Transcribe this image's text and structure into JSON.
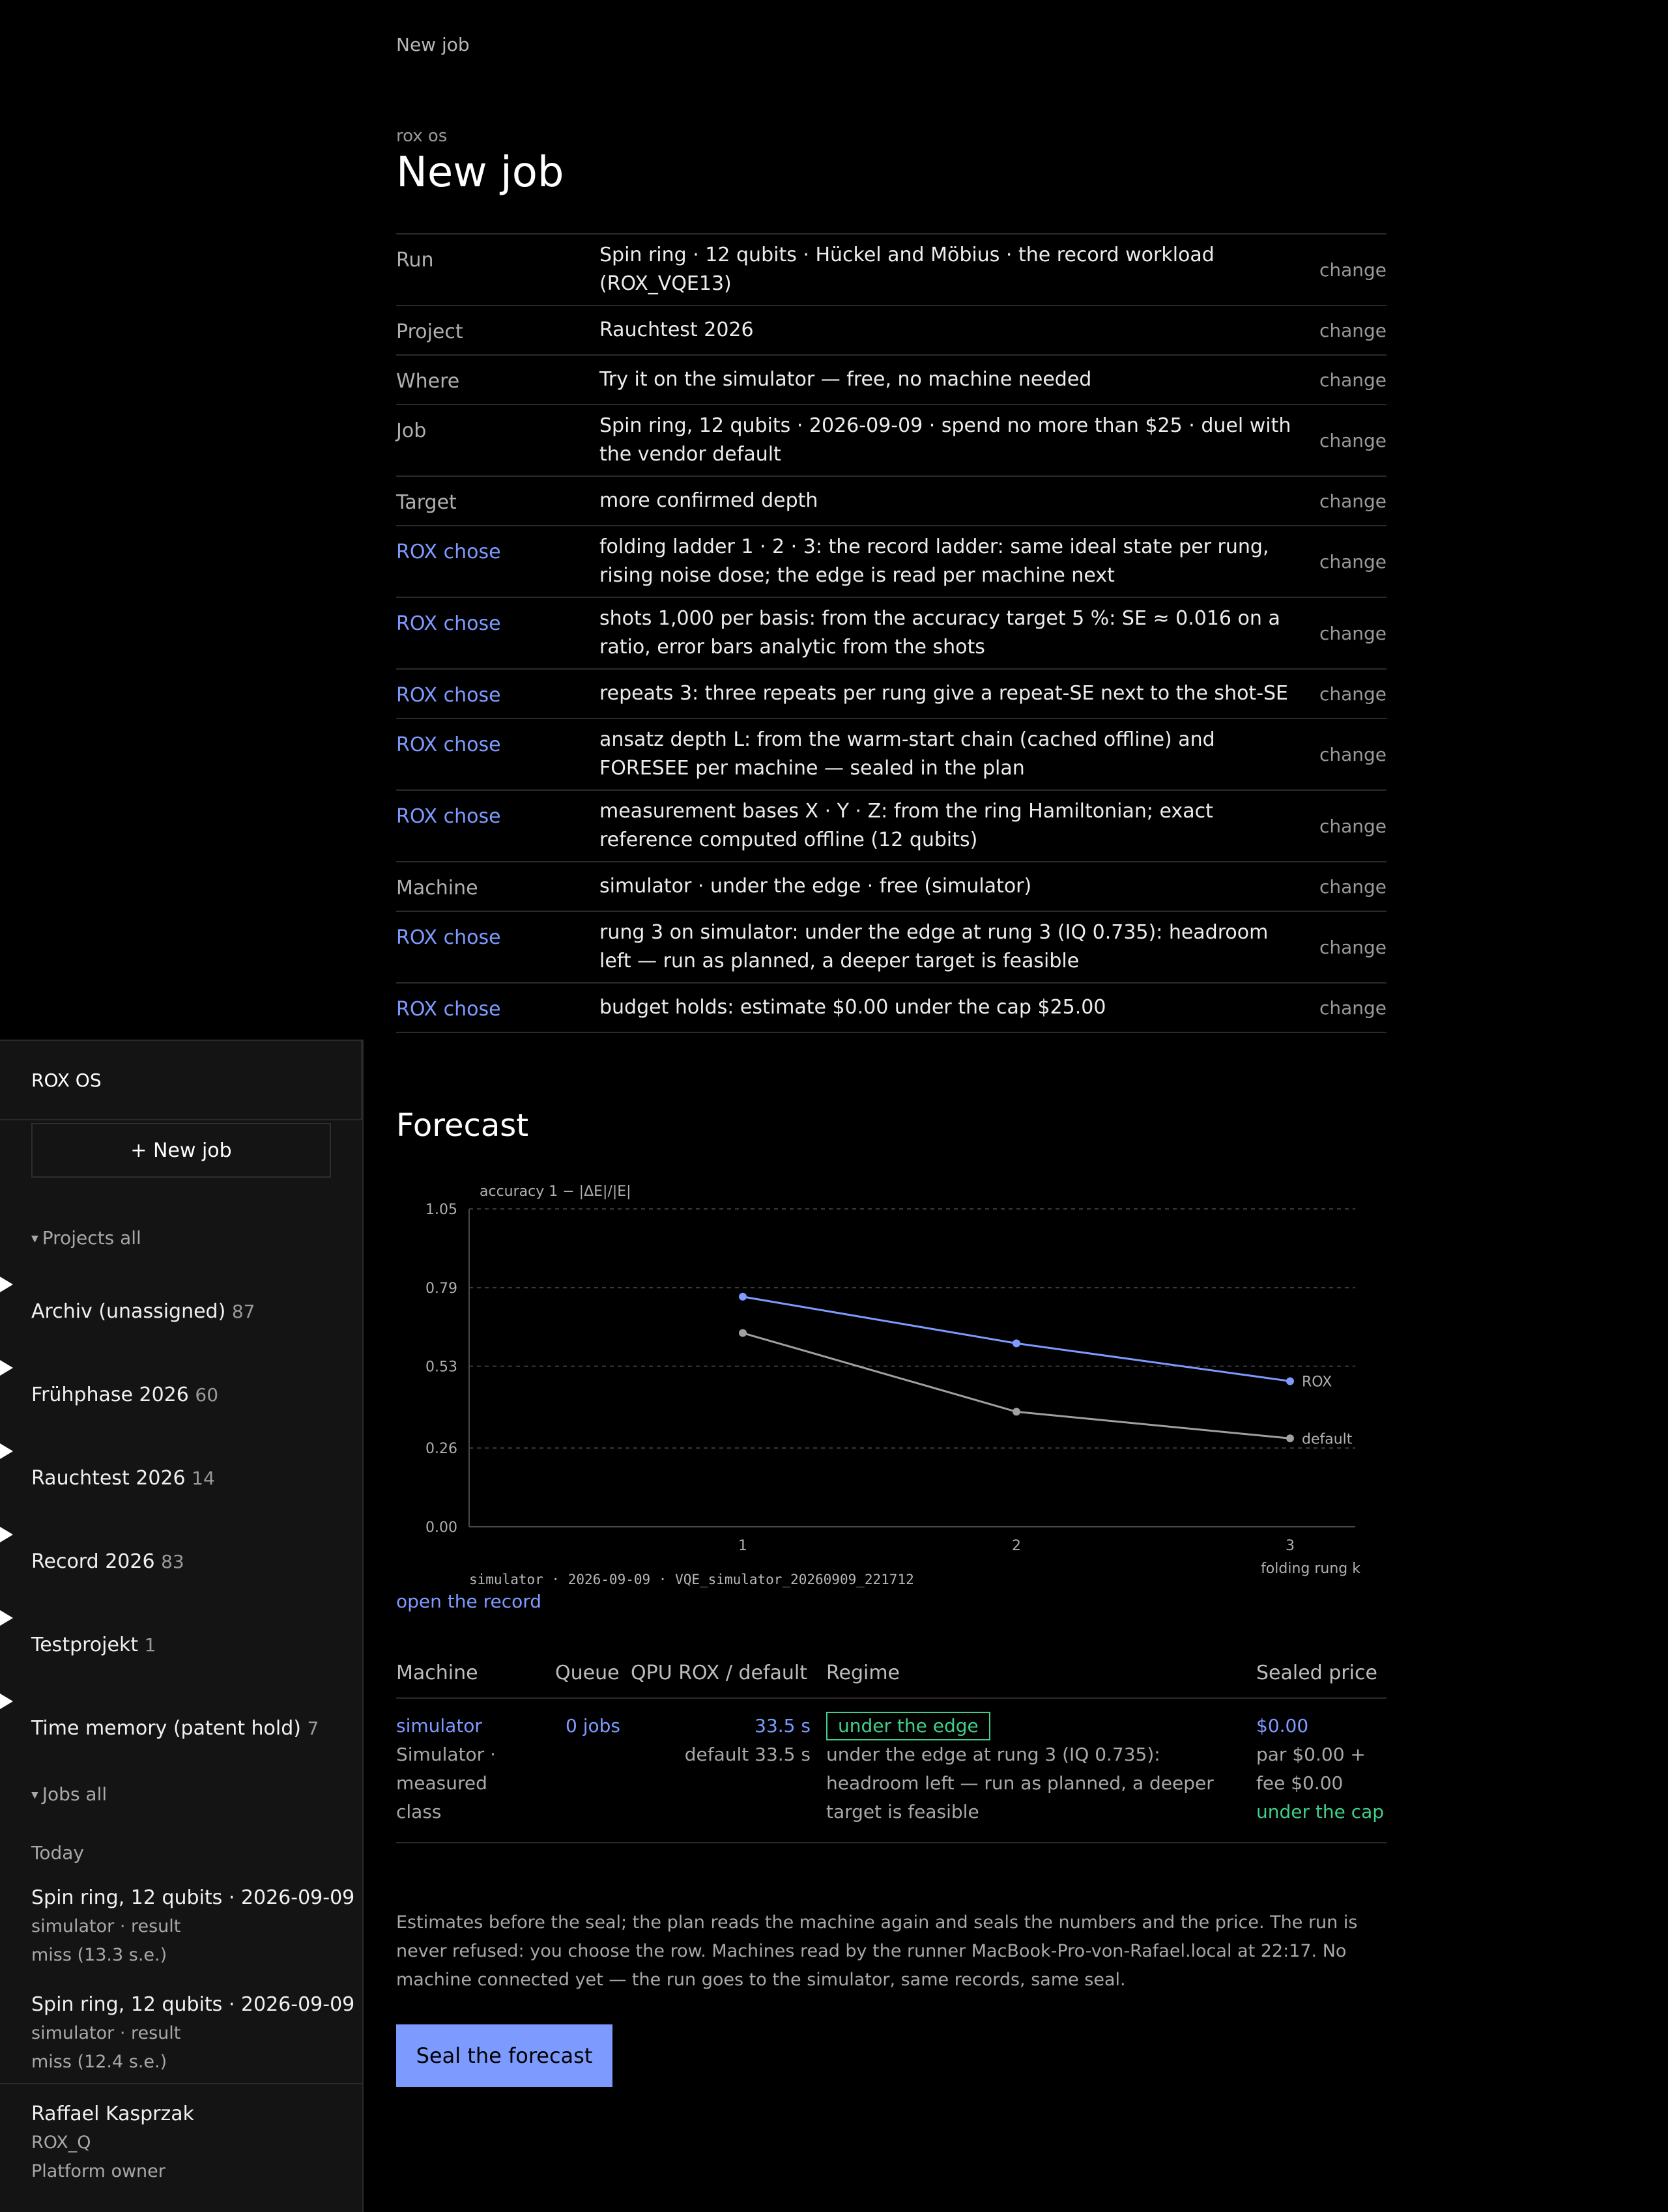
{
  "breadcrumb": "New job",
  "eyebrow": "rox os",
  "title": "New job",
  "change_label": "change",
  "spec_rows": [
    {
      "label": "Run",
      "value": "Spin ring · 12 qubits · Hückel and Möbius · the record workload (ROX_VQE13)",
      "rox": false
    },
    {
      "label": "Project",
      "value": "Rauchtest 2026",
      "rox": false
    },
    {
      "label": "Where",
      "value": "Try it on the simulator — free, no machine needed",
      "rox": false
    },
    {
      "label": "Job",
      "value": "Spin ring, 12 qubits · 2026-09-09 · spend no more than $25 · duel with the vendor default",
      "rox": false
    },
    {
      "label": "Target",
      "value": "more confirmed depth",
      "rox": false
    },
    {
      "label": "ROX chose",
      "value": "folding ladder 1 · 2 · 3: the record ladder: same ideal state per rung, rising noise dose; the edge is read per machine next",
      "rox": true
    },
    {
      "label": "ROX chose",
      "value": "shots 1,000 per basis: from the accuracy target 5 %: SE ≈ 0.016 on a ratio, error bars analytic from the shots",
      "rox": true
    },
    {
      "label": "ROX chose",
      "value": "repeats 3: three repeats per rung give a repeat-SE next to the shot-SE",
      "rox": true
    },
    {
      "label": "ROX chose",
      "value": "ansatz depth L: from the warm-start chain (cached offline) and FORESEE per machine — sealed in the plan",
      "rox": true
    },
    {
      "label": "ROX chose",
      "value": "measurement bases X · Y · Z: from the ring Hamiltonian; exact reference computed offline (12 qubits)",
      "rox": true
    },
    {
      "label": "Machine",
      "value": "simulator · under the edge · free (simulator)",
      "rox": false
    },
    {
      "label": "ROX chose",
      "value": "rung 3 on simulator: under the edge at rung 3 (IQ 0.735): headroom left — run as planned, a deeper target is feasible",
      "rox": true
    },
    {
      "label": "ROX chose",
      "value": "budget holds: estimate $0.00 under the cap $25.00",
      "rox": true
    }
  ],
  "forecast": {
    "heading": "Forecast",
    "caption": "simulator · 2026-09-09 · VQE_simulator_20260909_221712",
    "record_link": "open the record"
  },
  "chart_data": {
    "type": "line",
    "ylabel": "accuracy 1 − |ΔE|/|E|",
    "xlabel": "folding rung k",
    "x": [
      1,
      2,
      3
    ],
    "y_ticks": [
      "0.00",
      "0.26",
      "0.53",
      "0.79",
      "1.05"
    ],
    "ylim": [
      0,
      1.05
    ],
    "grid": true,
    "series": [
      {
        "name": "ROX",
        "values": [
          0.76,
          0.606,
          0.481
        ],
        "color": "#7d9bff"
      },
      {
        "name": "default",
        "values": [
          0.64,
          0.38,
          0.292
        ],
        "color": "#a0a0a0"
      }
    ]
  },
  "machines_table": {
    "headers": {
      "machine": "Machine",
      "queue": "Queue",
      "qpu": "QPU ROX / default",
      "regime": "Regime",
      "price": "Sealed price"
    },
    "row": {
      "machine": "simulator",
      "machine_sub": "Simulator · measured class",
      "queue": "0 jobs",
      "qpu_rox": "33.5 s",
      "qpu_default": "default 33.5 s",
      "regime_badge": "under the edge",
      "regime_text": "under the edge at rung 3 (IQ 0.735): headroom left — run as planned, a deeper target is feasible",
      "price": "$0.00",
      "price_detail": "par $0.00 + fee $0.00",
      "price_status": "under the cap"
    }
  },
  "footnote": "Estimates before the seal; the plan reads the machine again and seals the numbers and the price. The run is never refused: you choose the row. Machines read by the runner MacBook-Pro-von-Rafael.local at 22:17. No machine connected yet — the run goes to the simulator, same records, same seal.",
  "seal_button": "Seal the forecast",
  "sidebar": {
    "brand": "ROX OS",
    "new_job": "+ New job",
    "projects_header": "Projects all",
    "projects": [
      {
        "name": "Archiv (unassigned)",
        "count": "87"
      },
      {
        "name": "Frühphase 2026",
        "count": "60"
      },
      {
        "name": "Rauchtest 2026",
        "count": "14"
      },
      {
        "name": "Record 2026",
        "count": "83"
      },
      {
        "name": "Testprojekt",
        "count": "1"
      },
      {
        "name": "Time memory (patent hold)",
        "count": "7"
      }
    ],
    "jobs_header": "Jobs all",
    "today": "Today",
    "jobs": [
      {
        "title": "Spin ring, 12 qubits · 2026-09-09",
        "meta1": "simulator · result",
        "meta2": "miss (13.3 s.e.)"
      },
      {
        "title": "Spin ring, 12 qubits · 2026-09-09",
        "meta1": "simulator · result",
        "meta2": "miss (12.4 s.e.)"
      }
    ],
    "user": {
      "name": "Raffael Kasprzak",
      "org": "ROX_Q",
      "role": "Platform owner"
    }
  }
}
